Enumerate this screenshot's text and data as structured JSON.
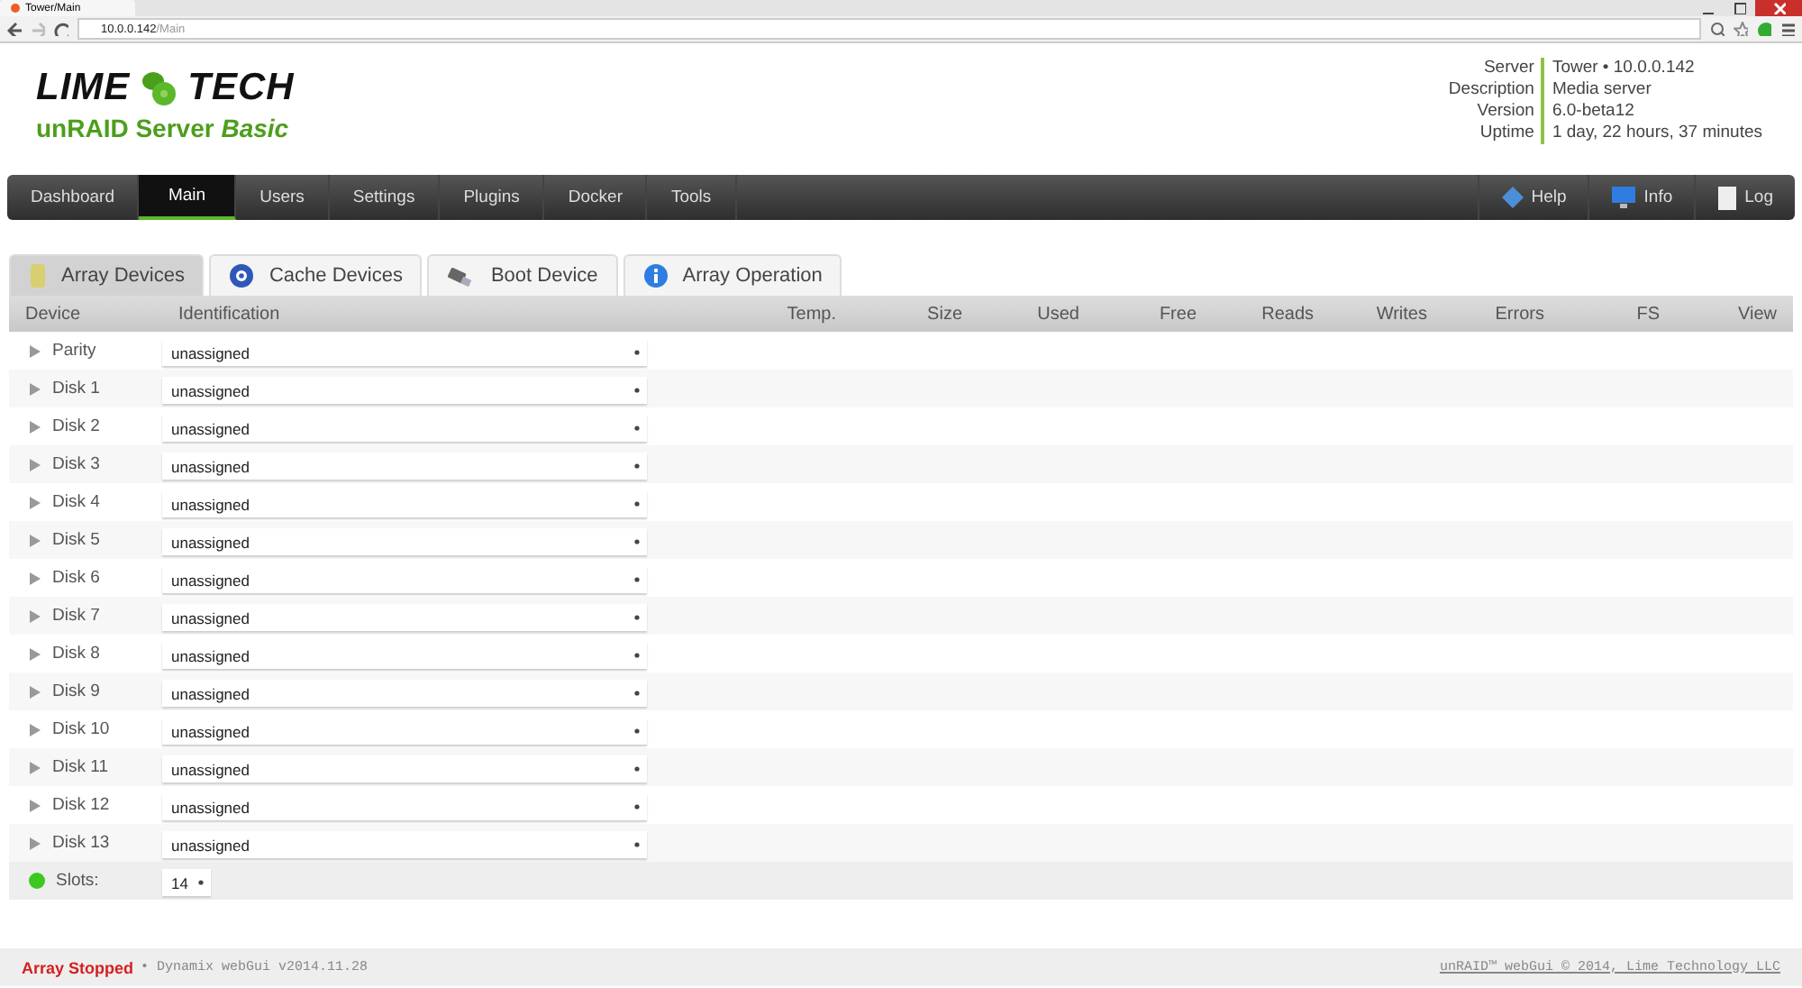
{
  "browser": {
    "tab_title": "Tower/Main",
    "url_host": "10.0.0.142",
    "url_path": "/Main"
  },
  "header": {
    "logo_left": "LIME",
    "logo_right": "TECH",
    "product": "unRAID Server *Basic*",
    "info": [
      {
        "label": "Server",
        "value": "Tower • 10.0.0.142"
      },
      {
        "label": "Description",
        "value": "Media server"
      },
      {
        "label": "Version",
        "value": "6.0-beta12"
      },
      {
        "label": "Uptime",
        "value": "1 day, 22 hours, 37 minutes"
      }
    ]
  },
  "nav": [
    {
      "label": "Dashboard",
      "selected": false
    },
    {
      "label": "Main",
      "selected": true
    },
    {
      "label": "Users",
      "selected": false
    },
    {
      "label": "Settings",
      "selected": false
    },
    {
      "label": "Plugins",
      "selected": false
    },
    {
      "label": "Docker",
      "selected": false
    },
    {
      "label": "Tools",
      "selected": false
    }
  ],
  "nav_right": [
    {
      "label": "Help",
      "kind": "help"
    },
    {
      "label": "Info",
      "kind": "info"
    },
    {
      "label": "Log",
      "kind": "log"
    }
  ],
  "tabs": [
    {
      "label": "Array Devices",
      "kind": "array",
      "selected": true
    },
    {
      "label": "Cache Devices",
      "kind": "cache",
      "selected": false
    },
    {
      "label": "Boot Device",
      "kind": "boot",
      "selected": false
    },
    {
      "label": "Array Operation",
      "kind": "operation",
      "selected": false
    }
  ],
  "table": {
    "columns": [
      "Device",
      "Identification",
      "Temp.",
      "Size",
      "Used",
      "Free",
      "Reads",
      "Writes",
      "Errors",
      "FS",
      "View"
    ],
    "rows": [
      {
        "device": "Parity",
        "identification": "unassigned"
      },
      {
        "device": "Disk 1",
        "identification": "unassigned"
      },
      {
        "device": "Disk 2",
        "identification": "unassigned"
      },
      {
        "device": "Disk 3",
        "identification": "unassigned"
      },
      {
        "device": "Disk 4",
        "identification": "unassigned"
      },
      {
        "device": "Disk 5",
        "identification": "unassigned"
      },
      {
        "device": "Disk 6",
        "identification": "unassigned"
      },
      {
        "device": "Disk 7",
        "identification": "unassigned"
      },
      {
        "device": "Disk 8",
        "identification": "unassigned"
      },
      {
        "device": "Disk 9",
        "identification": "unassigned"
      },
      {
        "device": "Disk 10",
        "identification": "unassigned"
      },
      {
        "device": "Disk 11",
        "identification": "unassigned"
      },
      {
        "device": "Disk 12",
        "identification": "unassigned"
      },
      {
        "device": "Disk 13",
        "identification": "unassigned"
      }
    ],
    "slots": {
      "label": "Slots:",
      "value": "14",
      "color": "#3cc81e"
    }
  },
  "footer": {
    "status": "Array Stopped",
    "version": "• Dynamix webGui v2014.11.28",
    "copyright": "unRAID™ webGui © 2014, Lime Technology LLC"
  }
}
